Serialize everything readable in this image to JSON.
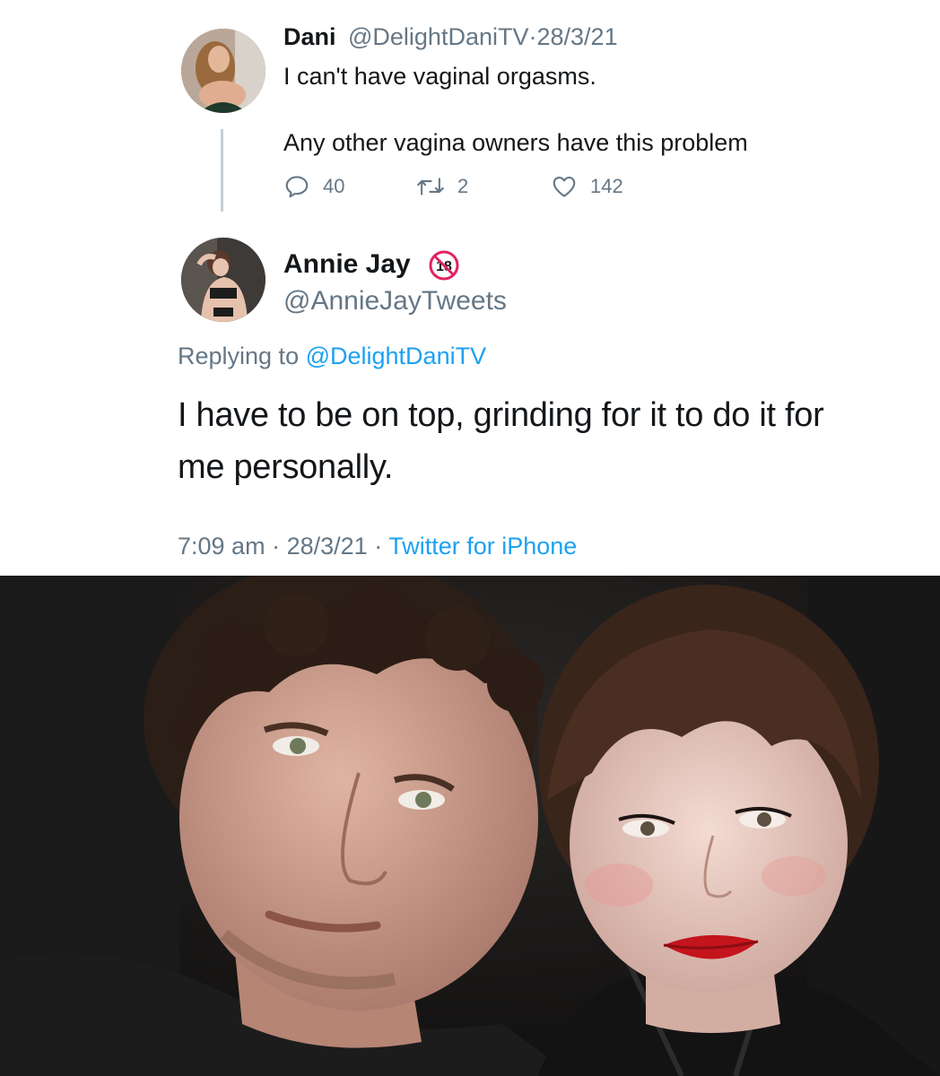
{
  "tweet_original": {
    "display_name": "Dani",
    "handle": "@DelightDaniTV",
    "separator": "·",
    "date": "28/3/21",
    "line1": "I can't have vaginal orgasms.",
    "line2": "Any other vagina owners have this problem",
    "reply_count": "40",
    "retweet_count": "2",
    "like_count": "142",
    "icons": [
      "reply-icon",
      "retweet-icon",
      "like-icon"
    ]
  },
  "tweet_reply": {
    "display_name": "Annie Jay",
    "badge": "18",
    "handle": "@AnnieJayTweets",
    "replying_prefix": "Replying to ",
    "replying_handle": "@DelightDaniTV",
    "body": "I have to be on top, grinding for it to do it for me personally.",
    "time": "7:09 am",
    "separator": "·",
    "date": "28/3/21",
    "client": "Twitter for iPhone"
  },
  "colors": {
    "text": "#14171a",
    "muted": "#657786",
    "link": "#1da1f2",
    "thread_line": "#c4cfd6",
    "badge_red": "#e0245e"
  }
}
